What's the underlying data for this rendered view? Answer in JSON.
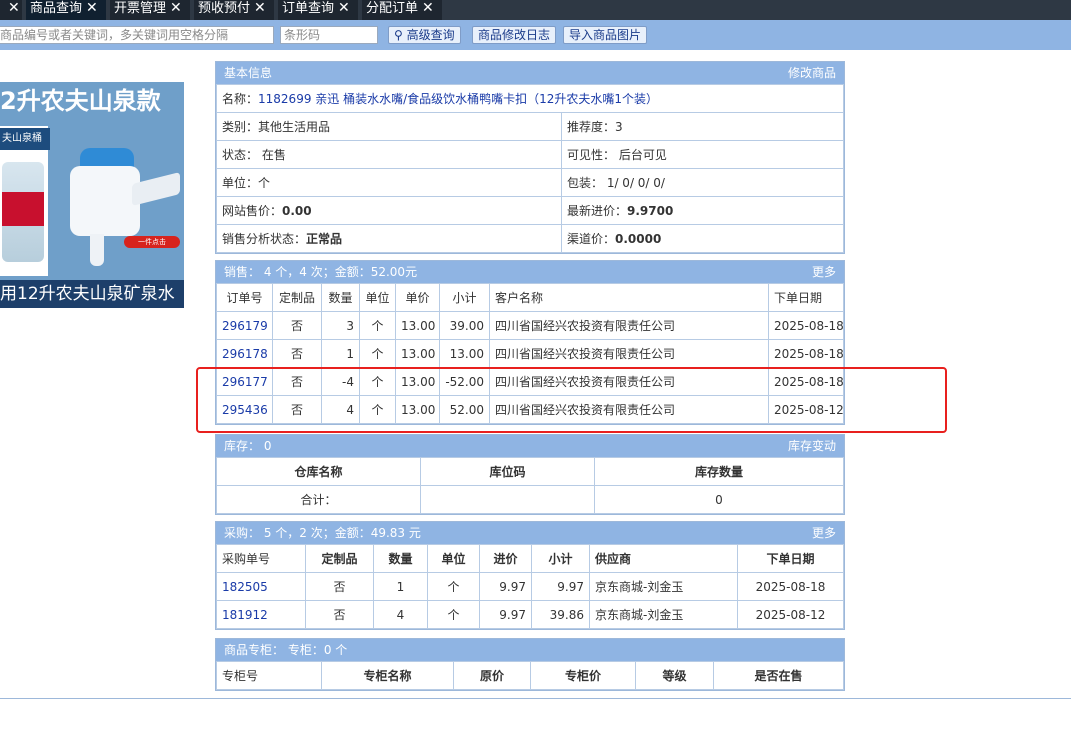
{
  "tabs": [
    {
      "label": ""
    },
    {
      "label": "商品查询"
    },
    {
      "label": "开票管理"
    },
    {
      "label": "预收预付"
    },
    {
      "label": "订单查询"
    },
    {
      "label": "分配订单"
    }
  ],
  "search": {
    "keyword_placeholder": "商品编号或者关键词，多关键词用空格分隔",
    "barcode_placeholder": "条形码",
    "advanced_label": "高级查询",
    "log_label": "商品修改日志",
    "import_label": "导入商品图片"
  },
  "product_image": {
    "top_text": "2升农夫山泉款",
    "tag_text": "夫山泉桶",
    "badge_text": "一件点击",
    "bottom_text": "用12升农夫山泉矿泉水"
  },
  "basic": {
    "header": "基本信息",
    "edit_label": "修改商品",
    "name_label": "名称：",
    "name_value": "1182699 亲迅 桶装水水嘴/食品级饮水桶鸭嘴卡扣（12升农夫水嘴1个装）",
    "category": "类别：其他生活用品",
    "recommend": "推荐度：3",
    "status": "状态： 在售",
    "visibility": "可见性： 后台可见",
    "unit": "单位：个",
    "packing": "包装： 1/ 0/ 0/ 0/",
    "site_price_label": "网站售价：",
    "site_price": "0.00",
    "last_cost_label": "最新进价：",
    "last_cost": "9.9700",
    "analysis_label": "销售分析状态：",
    "analysis": "正常品",
    "channel_price_label": "渠道价：",
    "channel_price": "0.0000"
  },
  "sales": {
    "header": "销售： 4 个，4 次；金额：52.00元",
    "more_label": "更多",
    "columns": [
      "订单号",
      "定制品",
      "数量",
      "单位",
      "单价",
      "小计",
      "客户名称",
      "下单日期"
    ],
    "rows": [
      {
        "order": "296179",
        "custom": "否",
        "qty": "3",
        "unit": "个",
        "price": "13.00",
        "subtotal": "39.00",
        "customer": "四川省国经兴农投资有限责任公司",
        "date": "2025-08-18"
      },
      {
        "order": "296178",
        "custom": "否",
        "qty": "1",
        "unit": "个",
        "price": "13.00",
        "subtotal": "13.00",
        "customer": "四川省国经兴农投资有限责任公司",
        "date": "2025-08-18"
      },
      {
        "order": "296177",
        "custom": "否",
        "qty": "-4",
        "unit": "个",
        "price": "13.00",
        "subtotal": "-52.00",
        "customer": "四川省国经兴农投资有限责任公司",
        "date": "2025-08-18"
      },
      {
        "order": "295436",
        "custom": "否",
        "qty": "4",
        "unit": "个",
        "price": "13.00",
        "subtotal": "52.00",
        "customer": "四川省国经兴农投资有限责任公司",
        "date": "2025-08-12"
      }
    ]
  },
  "stock": {
    "header": "库存： 0",
    "change_label": "库存变动",
    "columns": [
      "仓库名称",
      "库位码",
      "库存数量"
    ],
    "total_label": "合计：",
    "total_value": "0"
  },
  "purchase": {
    "header": "采购： 5 个，2 次；金额：49.83 元",
    "more_label": "更多",
    "columns": [
      "采购单号",
      "定制品",
      "数量",
      "单位",
      "进价",
      "小计",
      "供应商",
      "下单日期"
    ],
    "rows": [
      {
        "order": "182505",
        "custom": "否",
        "qty": "1",
        "unit": "个",
        "price": "9.97",
        "subtotal": "9.97",
        "supplier": "京东商城-刘金玉",
        "date": "2025-08-18"
      },
      {
        "order": "181912",
        "custom": "否",
        "qty": "4",
        "unit": "个",
        "price": "9.97",
        "subtotal": "39.86",
        "supplier": "京东商城-刘金玉",
        "date": "2025-08-12"
      }
    ]
  },
  "counter": {
    "header": "商品专柜： 专柜：0 个",
    "columns": [
      "专柜号",
      "专柜名称",
      "原价",
      "专柜价",
      "等级",
      "是否在售"
    ]
  },
  "colors": {
    "header_blue": "#8fb4e3",
    "link": "#1a3ba8",
    "highlight": "#e8201e",
    "tabbar": "#2e3844"
  }
}
